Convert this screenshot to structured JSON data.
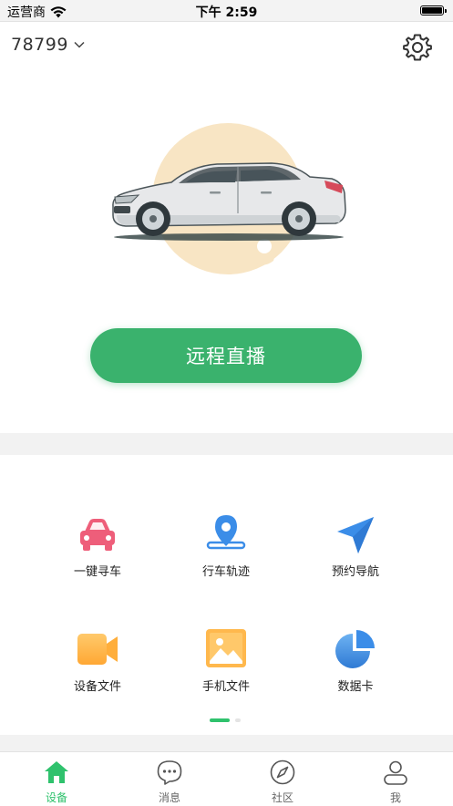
{
  "status_bar": {
    "carrier": "运营商",
    "time": "下午 2:59"
  },
  "header": {
    "device_id": "78799"
  },
  "hero": {
    "live_button_label": "远程直播"
  },
  "grid": {
    "items": [
      {
        "label": "一键寻车",
        "icon": "car-icon"
      },
      {
        "label": "行车轨迹",
        "icon": "location-pin-icon"
      },
      {
        "label": "预约导航",
        "icon": "navigation-arrow-icon"
      },
      {
        "label": "设备文件",
        "icon": "video-camera-icon"
      },
      {
        "label": "手机文件",
        "icon": "image-icon"
      },
      {
        "label": "数据卡",
        "icon": "pie-chart-icon"
      }
    ],
    "page_count": 2,
    "current_page": 1
  },
  "tab_bar": {
    "tabs": [
      {
        "label": "设备",
        "icon": "home-icon",
        "active": true
      },
      {
        "label": "消息",
        "icon": "chat-bubble-icon",
        "active": false
      },
      {
        "label": "社区",
        "icon": "compass-icon",
        "active": false
      },
      {
        "label": "我",
        "icon": "user-icon",
        "active": false
      }
    ]
  },
  "colors": {
    "accent_green": "#3ab26d",
    "tab_active": "#2fc26d",
    "hero_circle": "#f8e5c4",
    "car_red": "#ee5e7a",
    "pin_blue": "#3b8de8",
    "camera_orange": "#ffb347"
  }
}
